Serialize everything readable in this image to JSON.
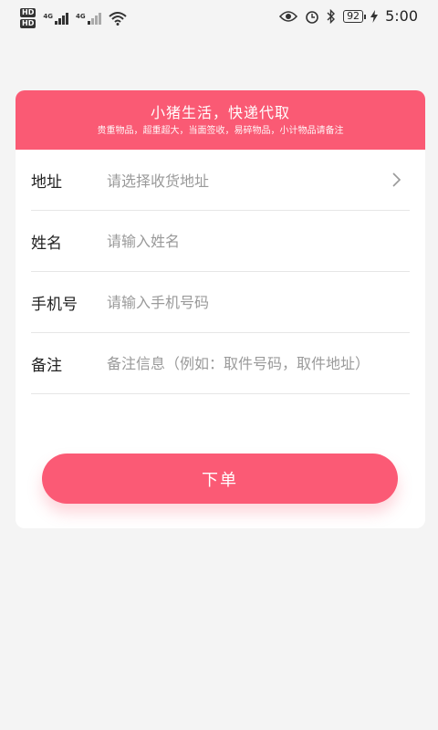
{
  "status_bar": {
    "hd1": "HD",
    "hd2": "HD",
    "net1": "4G",
    "net2": "4G",
    "battery": "92",
    "time": "5:00"
  },
  "banner": {
    "title": "小猪生活，快递代取",
    "subtitle": "贵重物品，超重超大，当面签收，易碎物品，小计物品请备注"
  },
  "form": {
    "address": {
      "label": "地址",
      "value": "请选择收货地址"
    },
    "name": {
      "label": "姓名",
      "placeholder": "请输入姓名"
    },
    "phone": {
      "label": "手机号",
      "placeholder": "请输入手机号码"
    },
    "remark": {
      "label": "备注",
      "placeholder": "备注信息（例如：取件号码，取件地址）"
    }
  },
  "submit_label": "下单",
  "colors": {
    "accent": "#fa5a74",
    "background": "#f4f4f4"
  }
}
